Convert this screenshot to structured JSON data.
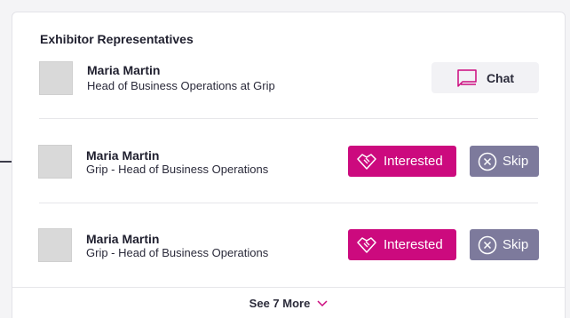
{
  "section": {
    "title": "Exhibitor Representatives"
  },
  "representative": {
    "name": "Maria Martin",
    "role": "Head of Business Operations at Grip",
    "chat_label": "Chat"
  },
  "recommendations": [
    {
      "name": "Maria Martin",
      "role": "Grip - Head of Business Operations",
      "interested_label": "Interested",
      "skip_label": "Skip"
    },
    {
      "name": "Maria Martin",
      "role": "Grip - Head of Business Operations",
      "interested_label": "Interested",
      "skip_label": "Skip"
    }
  ],
  "footer": {
    "see_more_label": "See 7 More"
  },
  "colors": {
    "accent": "#cc0a7e",
    "skip": "#7d7a9c",
    "chat_bg": "#f2f2f5"
  },
  "icons": {
    "chat": "chat-bubble-icon",
    "interested": "handshake-icon",
    "skip": "close-circle-icon",
    "more": "chevron-down-icon"
  }
}
